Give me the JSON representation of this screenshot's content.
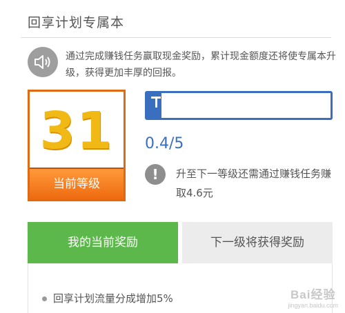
{
  "header": {
    "title": "回享计划专属本"
  },
  "notice": {
    "icon": "speaker-icon",
    "text": "通过完成赚钱任务赢取现金奖励，累计现金额度还将使专属本升级，获得更加丰厚的回报。"
  },
  "level": {
    "number": "31",
    "label": "当前等级"
  },
  "progress": {
    "current": 0.4,
    "max": 5,
    "text": "0.4/5",
    "fill_color": "#3a6fbf"
  },
  "upgrade_hint": {
    "icon": "exclamation-icon",
    "text": "升至下一等级还需通过赚钱任务赚取4.6元"
  },
  "tabs": [
    {
      "label": "我的当前奖励",
      "active": true
    },
    {
      "label": "下一级将获得奖励",
      "active": false
    }
  ],
  "rewards": [
    {
      "text": "回享计划流量分成增加5%"
    }
  ],
  "watermark": {
    "logo_text": "Bai经验",
    "sub_text": "jingyan.baidu.com"
  },
  "colors": {
    "level_border": "#e06a12",
    "level_number": "#f0b915",
    "progress_blue": "#3a6fbf",
    "tab_active": "#5cb84a",
    "tab_inactive": "#ececec"
  }
}
